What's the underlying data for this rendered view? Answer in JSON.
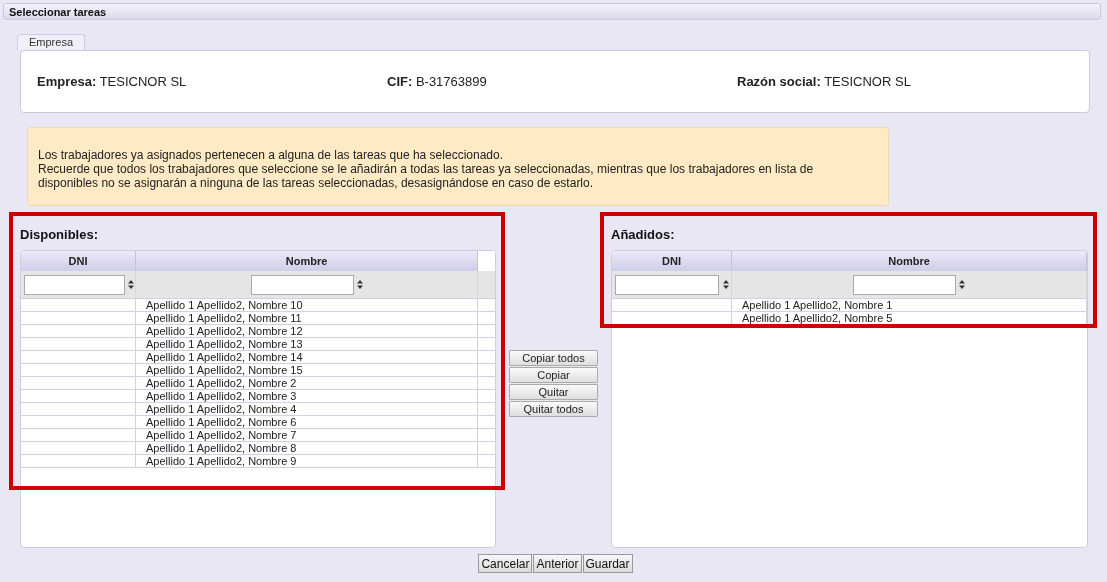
{
  "window": {
    "title": "Seleccionar tareas"
  },
  "tabs": [
    {
      "label": "Empresa",
      "selected": true
    }
  ],
  "company": [
    {
      "label": "Empresa:",
      "value": "TESICNOR SL"
    },
    {
      "label": "CIF:",
      "value": "B-31763899"
    },
    {
      "label": "Razón social:",
      "value": "TESICNOR SL"
    }
  ],
  "notice": [
    "Los trabajadores ya asignados pertenecen a alguna de las tareas que ha seleccionado.",
    "Recuerde que todos los trabajadores que seleccione se le añadirán a todas las tareas ya seleccionadas, mientras que los trabajadores en lista de disponibles no se asignarán a ninguna de las tareas seleccionadas, desasignándose en caso de estarlo."
  ],
  "lists": [
    {
      "title": "Disponibles:",
      "highlighted": true,
      "columns": [
        "DNI",
        "Nombre"
      ],
      "rows": [
        "Apellido 1 Apellido2, Nombre 10",
        "Apellido 1 Apellido2, Nombre 11",
        "Apellido 1 Apellido2, Nombre 12",
        "Apellido 1 Apellido2, Nombre 13",
        "Apellido 1 Apellido2, Nombre 14",
        "Apellido 1 Apellido2, Nombre 15",
        "Apellido 1 Apellido2, Nombre 2",
        "Apellido 1 Apellido2, Nombre 3",
        "Apellido 1 Apellido2, Nombre 4",
        "Apellido 1 Apellido2, Nombre 6",
        "Apellido 1 Apellido2, Nombre 7",
        "Apellido 1 Apellido2, Nombre 8",
        "Apellido 1 Apellido2, Nombre 9"
      ]
    },
    {
      "title": "Añadidos:",
      "highlighted": true,
      "columns": [
        "DNI",
        "Nombre"
      ],
      "rows": [
        "Apellido 1 Apellido2, Nombre 1",
        "Apellido 1 Apellido2, Nombre 5"
      ]
    }
  ],
  "transfer_buttons": [
    "Copiar todos",
    "Copiar",
    "Quitar",
    "Quitar todos"
  ],
  "footer_buttons": [
    "Cancelar",
    "Anterior",
    "Guardar"
  ]
}
